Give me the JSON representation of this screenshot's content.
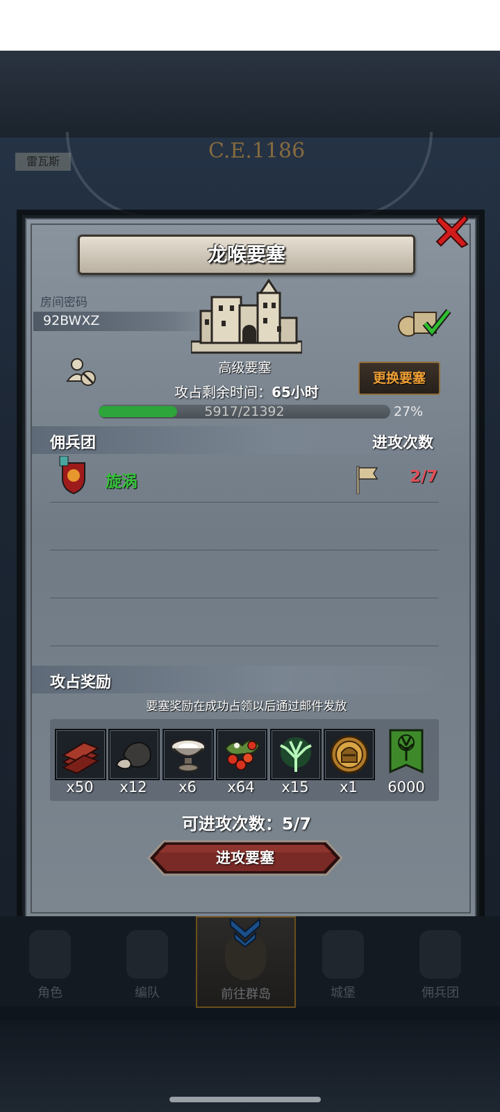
{
  "background": {
    "era_text": "C.E.1186",
    "left_tag": "雷瓦斯"
  },
  "dialog": {
    "title": "龙喉要塞",
    "room_label": "房间密码",
    "room_code": "92BWXZ",
    "fortress_level": "高级要塞",
    "change_button": "更换要塞",
    "remaining_label": "攻占剩余时间：",
    "remaining_value": "65",
    "remaining_unit": "小时",
    "progress_text": "5917/21392",
    "progress_percent": "27%",
    "progress_fraction": 0.27,
    "mercenaries_header": "佣兵团",
    "attacks_header": "进攻次数",
    "mercenaries": [
      {
        "name": "旋涡",
        "attacks": "2/7"
      }
    ],
    "rewards_header": "攻占奖励",
    "rewards_note": "要塞奖励在成功占领以后通过邮件发放",
    "rewards": [
      {
        "icon": "wood-planks-icon",
        "qty": "x50"
      },
      {
        "icon": "stone-ore-icon",
        "qty": "x12"
      },
      {
        "icon": "silver-bowl-icon",
        "qty": "x6"
      },
      {
        "icon": "berries-icon",
        "qty": "x64"
      },
      {
        "icon": "green-tree-spirit-icon",
        "qty": "x15"
      },
      {
        "icon": "knight-helmet-medal-icon",
        "qty": "x1"
      },
      {
        "icon": "tree-banner-icon",
        "qty": "6000"
      }
    ],
    "attacks_available_label": "可进攻次数：",
    "attacks_available_value": "5/7",
    "attack_button": "进攻要塞"
  },
  "nav": {
    "items": [
      {
        "label": "角色"
      },
      {
        "label": "编队"
      },
      {
        "label": "前往群岛"
      },
      {
        "label": "城堡"
      },
      {
        "label": "佣兵团"
      }
    ]
  },
  "colors": {
    "accent_green": "#35c23a",
    "count_red": "#e0505a",
    "close_red": "#d21c1c",
    "button_orange": "#f0a035"
  }
}
